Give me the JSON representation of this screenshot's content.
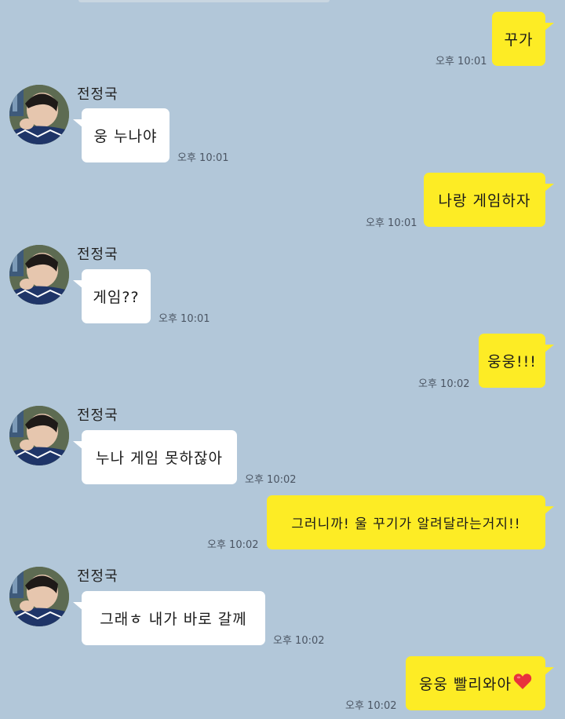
{
  "chat": {
    "sender_name": "전정국",
    "messages": [
      {
        "text": "꾸가",
        "time": "오후 10:01"
      },
      {
        "text": "웅 누나야",
        "time": "오후 10:01"
      },
      {
        "text": "나랑 게임하자",
        "time": "오후 10:01"
      },
      {
        "text": "게임??",
        "time": "오후 10:01"
      },
      {
        "text": "웅웅!!!",
        "time": "오후 10:02"
      },
      {
        "text": "누나 게임 못하잖아",
        "time": "오후 10:02"
      },
      {
        "text": "그러니까! 울 꾸기가 알려달라는거지!!",
        "time": "오후 10:02"
      },
      {
        "text": "그래ㅎ 내가 바로 갈께",
        "time": "오후 10:02"
      },
      {
        "text": "웅웅 빨리와아",
        "time": "오후 10:02",
        "emoji": "heart-emoji"
      }
    ]
  },
  "colors": {
    "background": "#b2c7d9",
    "my_bubble": "#fdec25",
    "their_bubble": "#ffffff",
    "heart": "#e8323c"
  }
}
